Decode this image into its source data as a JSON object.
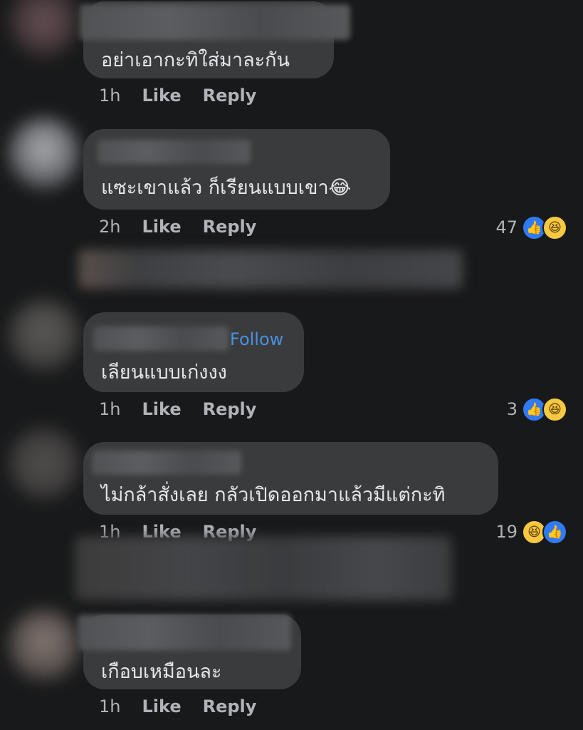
{
  "comments": [
    {
      "text": "อย่าเอากะทิใส่มาละกัน",
      "time": "1h",
      "like": "Like",
      "reply": "Reply"
    },
    {
      "text": "แซะเขาแล้ว ก็เรียนแบบเขา",
      "emoji": "😂",
      "time": "2h",
      "like": "Like",
      "reply": "Reply",
      "reaction_count": "47"
    },
    {
      "text": "เลียนแบบเก่งงง",
      "follow": "Follow",
      "time": "1h",
      "like": "Like",
      "reply": "Reply",
      "reaction_count": "3"
    },
    {
      "text": "ไม่กล้าสั่งเลย กลัวเปิดออกมาแล้วมีแต่กะทิ",
      "time": "1h",
      "like": "Like",
      "reply": "Reply",
      "reaction_count": "19"
    },
    {
      "text": "เกือบเหมือนละ",
      "time": "1h",
      "like": "Like",
      "reply": "Reply"
    }
  ],
  "icons": {
    "like": "like-icon",
    "haha": "haha-icon"
  },
  "colors": {
    "background": "#18191a",
    "bubble": "#3a3b3c",
    "link": "#4a90e2",
    "like_blue": "#2f7bf5",
    "haha_yellow": "#f7c842"
  }
}
